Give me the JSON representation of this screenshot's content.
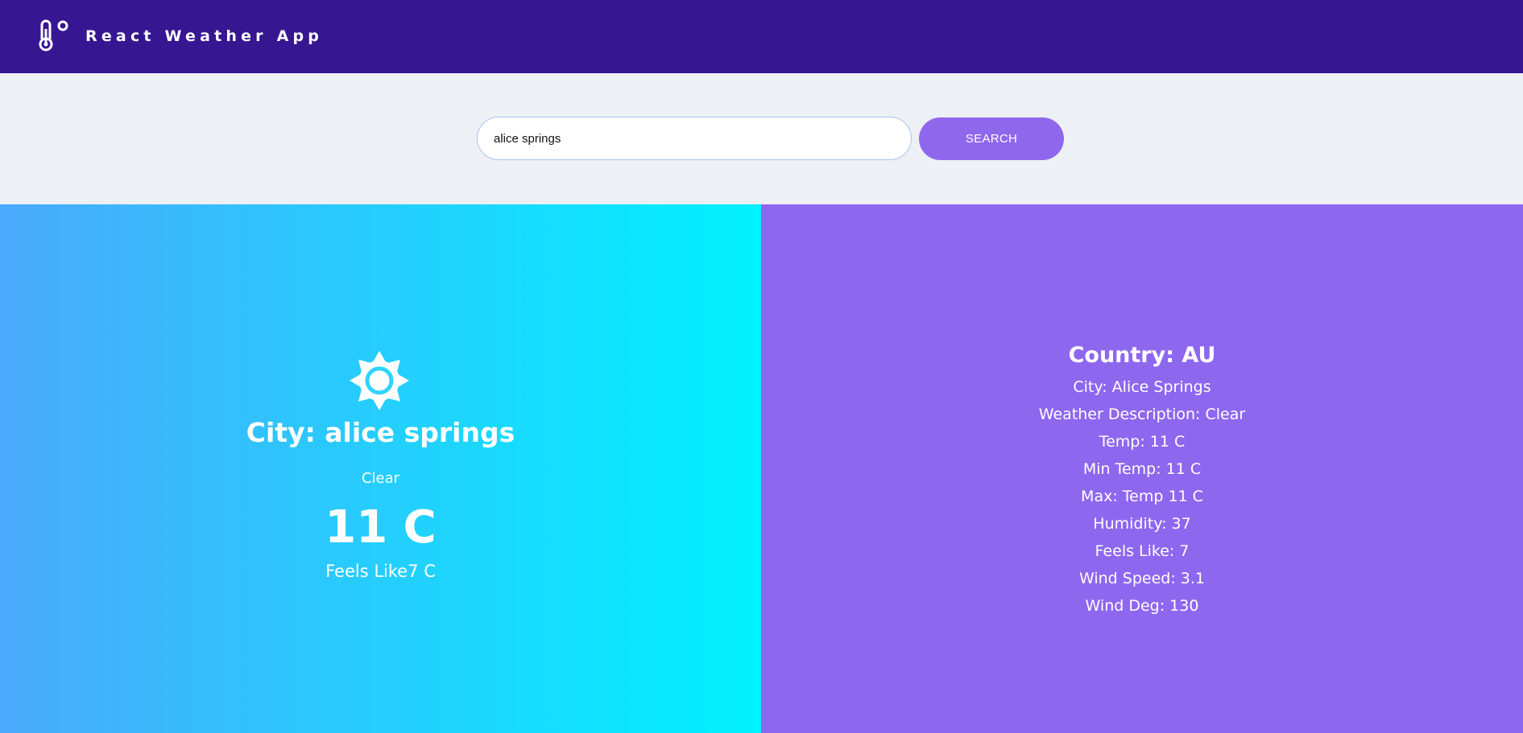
{
  "header": {
    "title": "React Weather App",
    "logo_icon": "thermometer-degree-icon"
  },
  "search": {
    "value": "alice springs",
    "button_label": "SEARCH"
  },
  "current": {
    "icon": "sun-icon",
    "city_heading": "City: alice springs",
    "description": "Clear",
    "temp": "11 C",
    "feels_like": "Feels Like7 C"
  },
  "details": {
    "country_heading": "Country: AU",
    "lines": [
      "City: Alice Springs",
      "Weather Description: Clear",
      "Temp: 11 C",
      "Min Temp: 11 C",
      "Max: Temp 11 C",
      "Humidity: 37",
      "Feels Like: 7",
      "Wind Speed: 3.1",
      "Wind Deg: 130"
    ]
  },
  "colors": {
    "header_bg": "#371692",
    "search_area_bg": "#edf0f5",
    "button_bg": "#8f67ec",
    "left_gradient_start": "#4aa9fc",
    "left_gradient_end": "#00f2fe",
    "right_panel_bg": "#8e67ef"
  }
}
